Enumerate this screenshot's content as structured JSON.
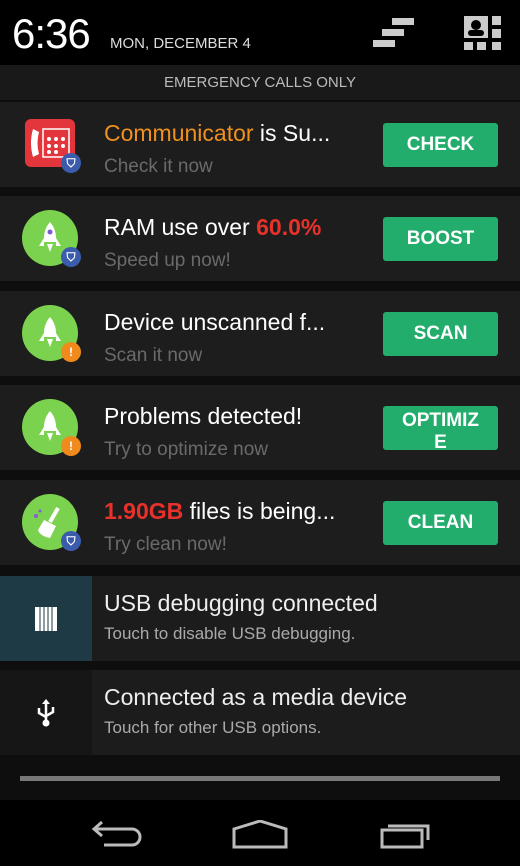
{
  "status": {
    "time": "6:36",
    "date": "MON, DECEMBER 4"
  },
  "emergency": "EMERGENCY CALLS ONLY",
  "notifications": [
    {
      "title_highlight": "Communicator",
      "title_rest": " is Su...",
      "highlight_color": "#f0901e",
      "subtitle": "Check it now",
      "button": "CHECK",
      "icon": "phone-app-icon",
      "badge": "shield-icon"
    },
    {
      "title_prefix": "RAM use over ",
      "title_highlight": "60.0%",
      "highlight_color": "#e8312b",
      "subtitle": "Speed up now!",
      "button": "BOOST",
      "icon": "rocket-icon",
      "badge": "shield-icon"
    },
    {
      "title": "Device unscanned f...",
      "subtitle": "Scan it now",
      "button": "SCAN",
      "icon": "rocket-icon",
      "badge": "warning-icon"
    },
    {
      "title": "Problems detected!",
      "subtitle": "Try to optimize now",
      "button": "OPTIMIZE",
      "icon": "rocket-icon",
      "badge": "warning-icon"
    },
    {
      "title_highlight": "1.90GB",
      "title_rest": " files is being...",
      "highlight_color": "#e8312b",
      "subtitle": "Try clean now!",
      "button": "CLEAN",
      "icon": "broom-icon",
      "badge": "shield-icon"
    }
  ],
  "system": [
    {
      "title": "USB debugging connected",
      "subtitle": "Touch to disable USB debugging.",
      "icon": "usb-debug-icon"
    },
    {
      "title": "Connected as a media device",
      "subtitle": "Touch for other USB options.",
      "icon": "usb-icon"
    }
  ],
  "colors": {
    "button": "#22ad6c",
    "debug_icon_bg": "#1e3a45"
  }
}
